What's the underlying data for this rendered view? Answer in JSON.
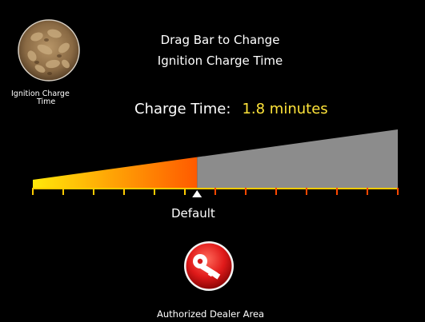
{
  "header": {
    "title_line1": "Drag Bar to Change",
    "title_line2": "Ignition Charge Time"
  },
  "pellet": {
    "icon": "wood-pellet-icon",
    "label_line1": "Ignition Charge",
    "label_line2": "Time"
  },
  "charge": {
    "label": "Charge Time:",
    "value": "1.8 minutes"
  },
  "slider": {
    "ticks": 13,
    "selected_fraction": 0.45,
    "default_fraction": 0.45,
    "colors": {
      "fill_start": "#ffe80a",
      "fill_end": "#ff5a00",
      "empty": "#8c8c8c",
      "tick_active": "#ffcc00",
      "tick_inactive": "#ff4800",
      "marker": "#ffffff"
    }
  },
  "default_label": "Default",
  "dealer": {
    "label": "Authorized Dealer Area",
    "icon": "key-icon",
    "button_color": "#e01a1a"
  }
}
